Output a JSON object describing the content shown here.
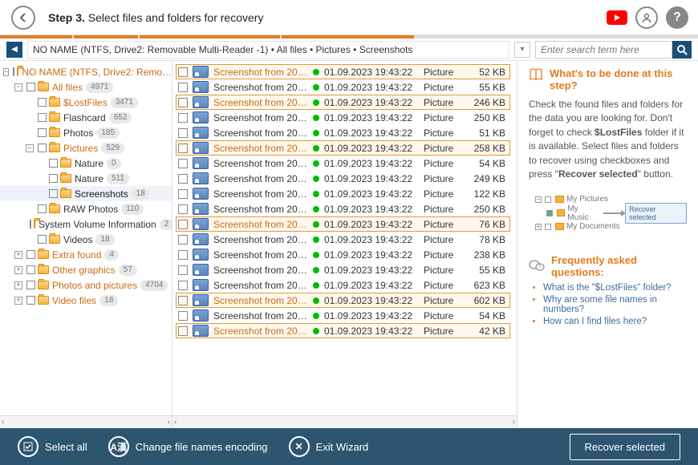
{
  "header": {
    "step_num": "Step 3.",
    "step_text": "Select files and folders for recovery"
  },
  "breadcrumb": "NO NAME (NTFS, Drive2: Removable Multi-Reader  -1)  •  All files  •  Pictures  •  Screenshots",
  "search_placeholder": "Enter search term here",
  "tree": {
    "root": {
      "name": "NO NAME (NTFS, Drive2: Remo…",
      "orange": true
    },
    "items": [
      {
        "ind": 1,
        "exp": "-",
        "name": "All files",
        "orange": true,
        "count": "4971"
      },
      {
        "ind": 2,
        "exp": "",
        "name": "$LostFiles",
        "orange": true,
        "count": "3471"
      },
      {
        "ind": 2,
        "exp": "",
        "name": "Flashcard",
        "count": "652"
      },
      {
        "ind": 2,
        "exp": "",
        "name": "Photos",
        "count": "185"
      },
      {
        "ind": 2,
        "exp": "-",
        "name": "Pictures",
        "orange": true,
        "count": "529"
      },
      {
        "ind": 3,
        "exp": "",
        "name": "Nature",
        "count": "0"
      },
      {
        "ind": 3,
        "exp": "",
        "name": "Nature",
        "count": "511"
      },
      {
        "ind": 3,
        "exp": "",
        "name": "Screenshots",
        "count": "18",
        "sel": true
      },
      {
        "ind": 2,
        "exp": "",
        "name": "RAW Photos",
        "count": "110"
      },
      {
        "ind": 2,
        "exp": "",
        "name": "System Volume Information",
        "count": "2"
      },
      {
        "ind": 2,
        "exp": "",
        "name": "Videos",
        "count": "18"
      },
      {
        "ind": 1,
        "exp": "+",
        "name": "Extra found",
        "orange": true,
        "count": "4"
      },
      {
        "ind": 1,
        "exp": "+",
        "name": "Other graphics",
        "orange": true,
        "count": "57"
      },
      {
        "ind": 1,
        "exp": "+",
        "name": "Photos and pictures",
        "orange": true,
        "count": "4704"
      },
      {
        "ind": 1,
        "exp": "+",
        "name": "Video files",
        "orange": true,
        "count": "18"
      }
    ]
  },
  "files": [
    {
      "name": "Screenshot from 20…",
      "date": "01.09.2023 19:43:22",
      "type": "Picture",
      "size": "52 KB",
      "hi": true,
      "orange": true
    },
    {
      "name": "Screenshot from 20…",
      "date": "01.09.2023 19:43:22",
      "type": "Picture",
      "size": "55 KB"
    },
    {
      "name": "Screenshot from 20…",
      "date": "01.09.2023 19:43:22",
      "type": "Picture",
      "size": "246 KB",
      "hi": true,
      "orange": true
    },
    {
      "name": "Screenshot from 20…",
      "date": "01.09.2023 19:43:22",
      "type": "Picture",
      "size": "250 KB"
    },
    {
      "name": "Screenshot from 20…",
      "date": "01.09.2023 19:43:22",
      "type": "Picture",
      "size": "51 KB"
    },
    {
      "name": "Screenshot from 20…",
      "date": "01.09.2023 19:43:22",
      "type": "Picture",
      "size": "258 KB",
      "hi": true,
      "orange": true
    },
    {
      "name": "Screenshot from 20…",
      "date": "01.09.2023 19:43:22",
      "type": "Picture",
      "size": "54 KB"
    },
    {
      "name": "Screenshot from 20…",
      "date": "01.09.2023 19:43:22",
      "type": "Picture",
      "size": "249 KB"
    },
    {
      "name": "Screenshot from 20…",
      "date": "01.09.2023 19:43:22",
      "type": "Picture",
      "size": "122 KB"
    },
    {
      "name": "Screenshot from 20…",
      "date": "01.09.2023 19:43:22",
      "type": "Picture",
      "size": "250 KB"
    },
    {
      "name": "Screenshot from 20…",
      "date": "01.09.2023 19:43:22",
      "type": "Picture",
      "size": "76 KB",
      "hi": true,
      "orange": true
    },
    {
      "name": "Screenshot from 20…",
      "date": "01.09.2023 19:43:22",
      "type": "Picture",
      "size": "78 KB"
    },
    {
      "name": "Screenshot from 20…",
      "date": "01.09.2023 19:43:22",
      "type": "Picture",
      "size": "238 KB"
    },
    {
      "name": "Screenshot from 20…",
      "date": "01.09.2023 19:43:22",
      "type": "Picture",
      "size": "55 KB"
    },
    {
      "name": "Screenshot from 20…",
      "date": "01.09.2023 19:43:22",
      "type": "Picture",
      "size": "623 KB"
    },
    {
      "name": "Screenshot from 20…",
      "date": "01.09.2023 19:43:22",
      "type": "Picture",
      "size": "602 KB",
      "hi": true,
      "orange": true
    },
    {
      "name": "Screenshot from 20…",
      "date": "01.09.2023 19:43:22",
      "type": "Picture",
      "size": "54 KB"
    },
    {
      "name": "Screenshot from 20…",
      "date": "01.09.2023 19:43:22",
      "type": "Picture",
      "size": "42 KB",
      "hi": true,
      "orange": true
    }
  ],
  "side": {
    "title": "What's to be done at this step?",
    "text": "Check the found files and folders for the data you are looking for. Don't forget to check $LostFiles folder if it is available. Select files and folders to recover using checkboxes and press \"Recover selected\" button.",
    "mini": {
      "i1": "My Pictures",
      "i2": "My Music",
      "i3": "My Documents",
      "btn": "Recover selected"
    },
    "faq_title": "Frequently asked questions:",
    "faq": [
      "What is the \"$LostFiles\" folder?",
      "Why are some file names in numbers?",
      "How can I find files here?"
    ]
  },
  "bottom": {
    "select_all": "Select all",
    "encoding": "Change file names encoding",
    "exit": "Exit Wizard",
    "recover": "Recover selected"
  }
}
